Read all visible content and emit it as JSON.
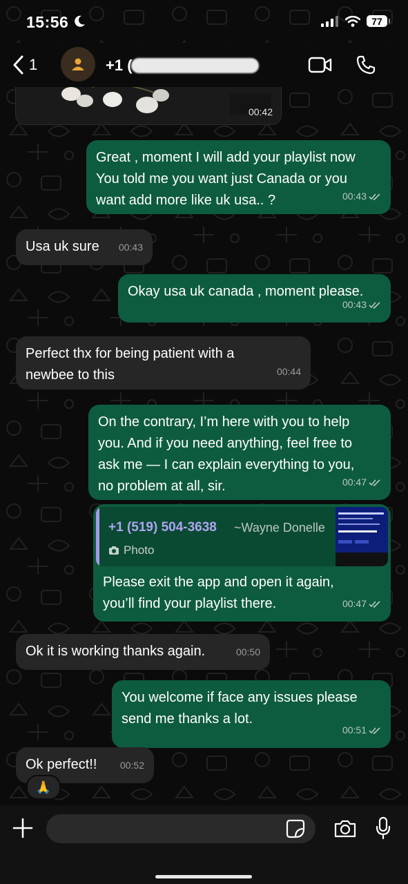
{
  "status_bar": {
    "time": "15:56",
    "battery": "77"
  },
  "header": {
    "back_count": "1",
    "contact_name": "+1 ("
  },
  "media": {
    "time": "00:42"
  },
  "messages": [
    {
      "dir": "out",
      "text": "Great , moment I will add your playlist now\nYou told me you want just Canada or you\nwant add more like uk usa.. ?",
      "time": "00:43"
    },
    {
      "dir": "in",
      "text": "Usa uk sure",
      "time": "00:43"
    },
    {
      "dir": "out",
      "text": "Okay usa uk canada , moment please.",
      "time": "00:43"
    },
    {
      "dir": "in",
      "text": "Perfect thx for being patient with a\nnewbee to this",
      "time": "00:44"
    },
    {
      "dir": "out",
      "text": "On the contrary, I’m here with you to help\nyou. And if you need anything, feel free to\nask me — I can explain everything to you,\nno problem at all, sir.",
      "time": "00:47"
    },
    {
      "dir": "out",
      "text": "Please exit the app and open it again,\nyou’ll find your playlist there.",
      "time": "00:47",
      "quote": {
        "number": "+1 (519) 504-3638",
        "name": "~Wayne Donelle",
        "label": "Photo"
      }
    },
    {
      "dir": "in",
      "text": "Ok it is working thanks again.",
      "time": "00:50"
    },
    {
      "dir": "out",
      "text": "You welcome if face any issues please\nsend me thanks a lot.",
      "time": "00:51"
    },
    {
      "dir": "in",
      "text": "Ok perfect!!",
      "time": "00:52"
    }
  ],
  "reaction": "🙏",
  "composer": {
    "placeholder": ""
  },
  "icons": [
    "moon-icon",
    "signal-icon",
    "wifi-icon",
    "battery-icon",
    "back-chevron-icon",
    "avatar-person-icon",
    "video-call-icon",
    "phone-icon",
    "read-receipt-icon",
    "camera-small-icon",
    "plus-icon",
    "sticker-icon",
    "camera-icon",
    "microphone-icon"
  ],
  "colors": {
    "outgoing_bubble": "#0e5c3f",
    "incoming_bubble": "#262626",
    "quote_accent": "#a49ae8",
    "background": "#0b0b0b"
  }
}
